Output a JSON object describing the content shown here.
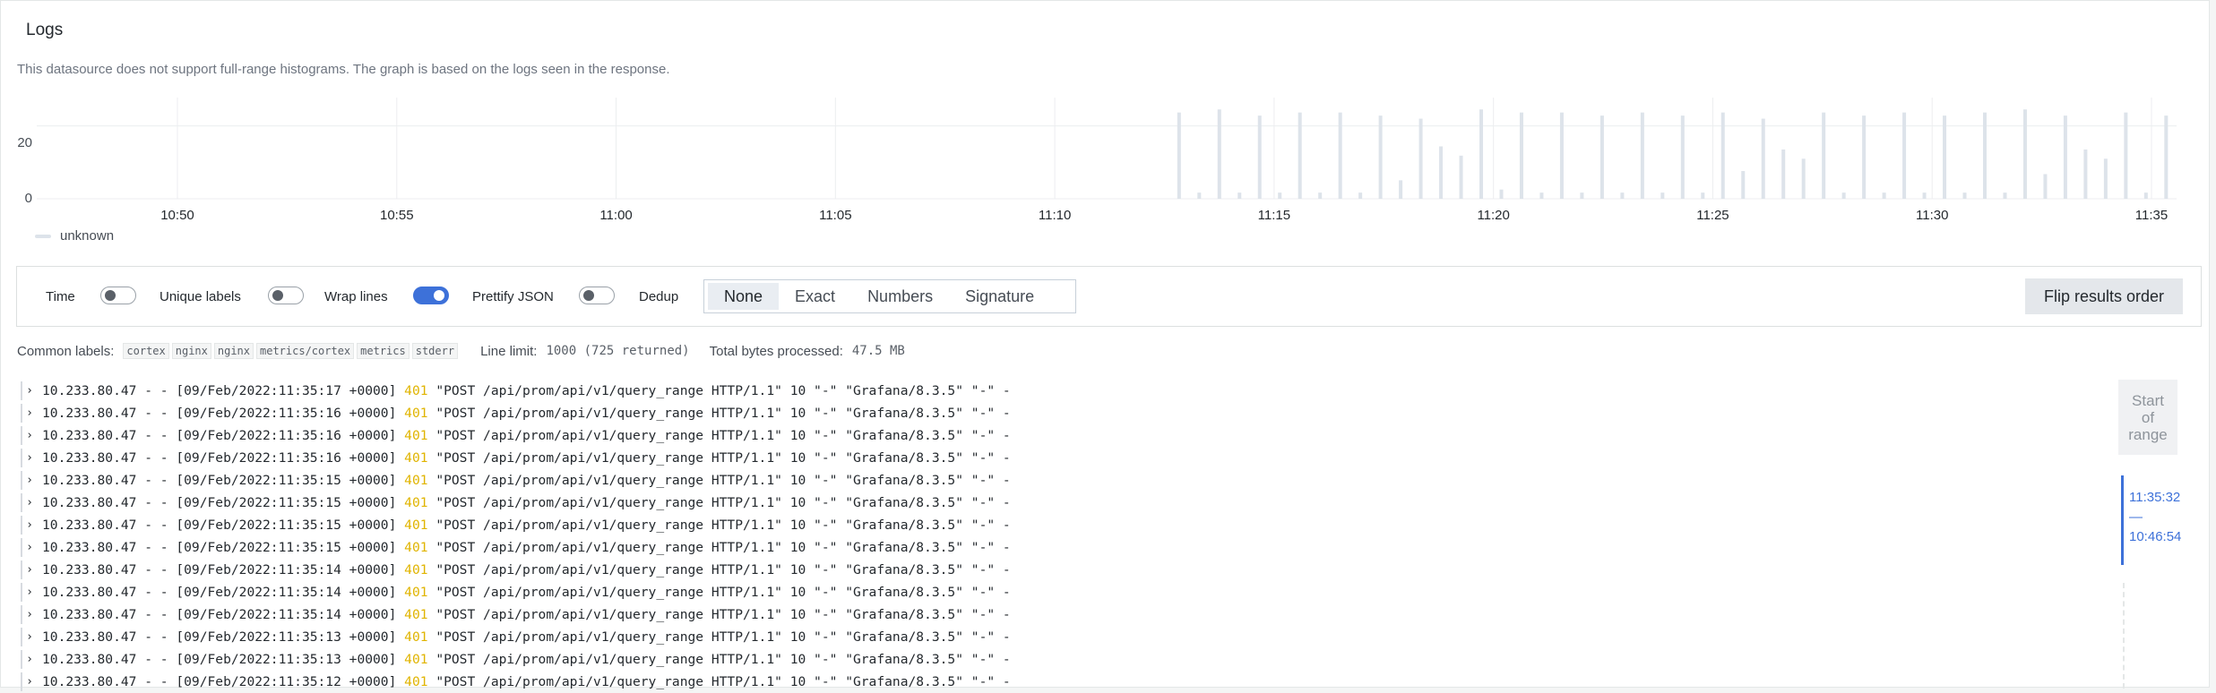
{
  "panel": {
    "title": "Logs",
    "notice": "This datasource does not support full-range histograms. The graph is based on the logs seen in the response."
  },
  "histogram": {
    "y_ticks": [
      "20",
      "0"
    ],
    "x_ticks": [
      "10:50",
      "10:55",
      "11:00",
      "11:05",
      "11:10",
      "11:15",
      "11:20",
      "11:25",
      "11:30",
      "11:35"
    ],
    "legend": "unknown",
    "bar_color": "#dde3ea",
    "chart_data": {
      "type": "bar",
      "series": [
        {
          "name": "unknown",
          "values": [
            28,
            2,
            29,
            2,
            27,
            2,
            28,
            2,
            28,
            2,
            27,
            6,
            26,
            17,
            14,
            29,
            3,
            28,
            2,
            28,
            2,
            27,
            2,
            28,
            2,
            27,
            2,
            28,
            9,
            26,
            16,
            13,
            28,
            2,
            27,
            2,
            28,
            2,
            27,
            2,
            28,
            2,
            29,
            8,
            27,
            16,
            13,
            28,
            2,
            27
          ]
        }
      ],
      "x_start": "11:12:50",
      "x_end": "11:35:20",
      "ylim": [
        0,
        30
      ],
      "grid": true
    }
  },
  "options": {
    "time_label": "Time",
    "time_on": false,
    "unique_labels_label": "Unique labels",
    "unique_labels_on": false,
    "wrap_lines_label": "Wrap lines",
    "wrap_lines_on": true,
    "prettify_json_label": "Prettify JSON",
    "prettify_json_on": false,
    "dedup_label": "Dedup",
    "dedup_options": [
      "None",
      "Exact",
      "Numbers",
      "Signature"
    ],
    "dedup_selected": "None",
    "flip_button": "Flip results order",
    "accent_color": "#3d71d9"
  },
  "meta": {
    "common_labels_label": "Common labels:",
    "common_labels": [
      "cortex",
      "nginx",
      "nginx",
      "metrics/cortex",
      "metrics",
      "stderr"
    ],
    "line_limit_label": "Line limit:",
    "line_limit_value": "1000 (725 returned)",
    "bytes_label": "Total bytes processed:",
    "bytes_value": "47.5 MB"
  },
  "logs": [
    {
      "pre": "10.233.80.47 - - [09/Feb/2022:11:35:17 +0000] ",
      "status": "401",
      "post": " \"POST /api/prom/api/v1/query_range HTTP/1.1\" 10 \"-\" \"Grafana/8.3.5\" \"-\" -"
    },
    {
      "pre": "10.233.80.47 - - [09/Feb/2022:11:35:16 +0000] ",
      "status": "401",
      "post": " \"POST /api/prom/api/v1/query_range HTTP/1.1\" 10 \"-\" \"Grafana/8.3.5\" \"-\" -"
    },
    {
      "pre": "10.233.80.47 - - [09/Feb/2022:11:35:16 +0000] ",
      "status": "401",
      "post": " \"POST /api/prom/api/v1/query_range HTTP/1.1\" 10 \"-\" \"Grafana/8.3.5\" \"-\" -"
    },
    {
      "pre": "10.233.80.47 - - [09/Feb/2022:11:35:16 +0000] ",
      "status": "401",
      "post": " \"POST /api/prom/api/v1/query_range HTTP/1.1\" 10 \"-\" \"Grafana/8.3.5\" \"-\" -"
    },
    {
      "pre": "10.233.80.47 - - [09/Feb/2022:11:35:15 +0000] ",
      "status": "401",
      "post": " \"POST /api/prom/api/v1/query_range HTTP/1.1\" 10 \"-\" \"Grafana/8.3.5\" \"-\" -"
    },
    {
      "pre": "10.233.80.47 - - [09/Feb/2022:11:35:15 +0000] ",
      "status": "401",
      "post": " \"POST /api/prom/api/v1/query_range HTTP/1.1\" 10 \"-\" \"Grafana/8.3.5\" \"-\" -"
    },
    {
      "pre": "10.233.80.47 - - [09/Feb/2022:11:35:15 +0000] ",
      "status": "401",
      "post": " \"POST /api/prom/api/v1/query_range HTTP/1.1\" 10 \"-\" \"Grafana/8.3.5\" \"-\" -"
    },
    {
      "pre": "10.233.80.47 - - [09/Feb/2022:11:35:15 +0000] ",
      "status": "401",
      "post": " \"POST /api/prom/api/v1/query_range HTTP/1.1\" 10 \"-\" \"Grafana/8.3.5\" \"-\" -"
    },
    {
      "pre": "10.233.80.47 - - [09/Feb/2022:11:35:14 +0000] ",
      "status": "401",
      "post": " \"POST /api/prom/api/v1/query_range HTTP/1.1\" 10 \"-\" \"Grafana/8.3.5\" \"-\" -"
    },
    {
      "pre": "10.233.80.47 - - [09/Feb/2022:11:35:14 +0000] ",
      "status": "401",
      "post": " \"POST /api/prom/api/v1/query_range HTTP/1.1\" 10 \"-\" \"Grafana/8.3.5\" \"-\" -"
    },
    {
      "pre": "10.233.80.47 - - [09/Feb/2022:11:35:14 +0000] ",
      "status": "401",
      "post": " \"POST /api/prom/api/v1/query_range HTTP/1.1\" 10 \"-\" \"Grafana/8.3.5\" \"-\" -"
    },
    {
      "pre": "10.233.80.47 - - [09/Feb/2022:11:35:13 +0000] ",
      "status": "401",
      "post": " \"POST /api/prom/api/v1/query_range HTTP/1.1\" 10 \"-\" \"Grafana/8.3.5\" \"-\" -"
    },
    {
      "pre": "10.233.80.47 - - [09/Feb/2022:11:35:13 +0000] ",
      "status": "401",
      "post": " \"POST /api/prom/api/v1/query_range HTTP/1.1\" 10 \"-\" \"Grafana/8.3.5\" \"-\" -"
    },
    {
      "pre": "10.233.80.47 - - [09/Feb/2022:11:35:12 +0000] ",
      "status": "401",
      "post": " \"POST /api/prom/api/v1/query_range HTTP/1.1\" 10 \"-\" \"Grafana/8.3.5\" \"-\" -"
    }
  ],
  "range_nav": {
    "start_text": "Start of range",
    "range_from": "11:35:32",
    "range_sep": "—",
    "range_to": "10:46:54"
  }
}
